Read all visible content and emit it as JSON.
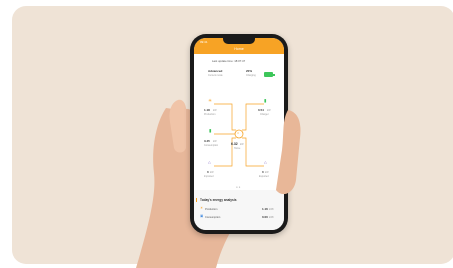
{
  "screen": {
    "status_time": "09:41",
    "title": "Home",
    "last_update": "Last update time: 18:07:47",
    "mode": {
      "value": "Advanced",
      "label": "Current mode"
    },
    "battery": {
      "percent": "20%",
      "label": "Charging"
    },
    "nodes": {
      "solar": {
        "value": "1.18",
        "unit": "kW",
        "label": "Production"
      },
      "battery": {
        "value": "3.45",
        "unit": "kW",
        "label": "Consumption"
      },
      "grid": {
        "value": "0",
        "unit": "kW",
        "label": "Imported"
      },
      "hub": {
        "value": "6.32",
        "unit": "kW",
        "label": "Home"
      },
      "ev": {
        "value": "0.54",
        "unit": "kW",
        "label": "Charger"
      },
      "load": {
        "value": "0",
        "unit": "kW",
        "label": "Exported"
      }
    },
    "analysis": {
      "title": "Today's energy analysis",
      "rows": [
        {
          "label": "Production",
          "value": "1.16",
          "unit": "kWh"
        },
        {
          "label": "Consumption",
          "value": "0.00",
          "unit": "kWh"
        }
      ]
    },
    "colors": {
      "accent": "#f7a325",
      "battery": "#3dc65a",
      "background": "#efe3d6"
    }
  }
}
